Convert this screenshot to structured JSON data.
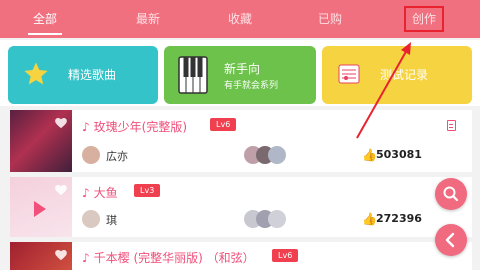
{
  "tabs": [
    {
      "label": "全部",
      "active": true
    },
    {
      "label": "最新",
      "active": false
    },
    {
      "label": "收藏",
      "active": false
    },
    {
      "label": "已购",
      "active": false
    },
    {
      "label": "创作",
      "active": false
    }
  ],
  "cards": [
    {
      "label": "精选歌曲",
      "subtitle": "",
      "color": "#33c3c8",
      "icon": "star-icon"
    },
    {
      "label": "新手向",
      "subtitle": "有手就会系列",
      "color": "#6cc24a",
      "icon": "piano-icon"
    },
    {
      "label": "测试记录",
      "subtitle": "",
      "color": "#f6d340",
      "icon": "music-sheet-icon"
    }
  ],
  "songs": [
    {
      "title": "玫瑰少年(完整版)",
      "level": "Lv6",
      "author": "広亦",
      "likes": "503081"
    },
    {
      "title": "大鱼",
      "level": "Lv3",
      "author": "琪",
      "likes": "272396"
    },
    {
      "title": "千本樱 (完整华丽版) （和弦）",
      "level": "Lv6",
      "author": "",
      "likes": ""
    }
  ],
  "colors": {
    "accent": "#f07080",
    "annotation_red": "#e8232f",
    "level_badge": "#f04050"
  },
  "fabs": [
    {
      "icon": "search-icon"
    },
    {
      "icon": "back-arrow-icon"
    }
  ]
}
